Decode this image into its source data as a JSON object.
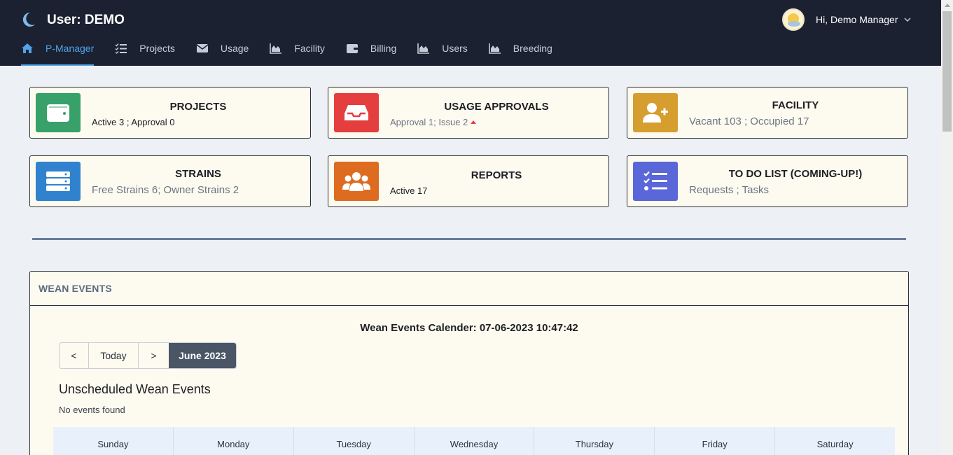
{
  "header": {
    "title": "User: DEMO",
    "greeting": "Hi, Demo Manager",
    "nav": [
      {
        "label": "P-Manager",
        "icon": "home-icon",
        "active": true
      },
      {
        "label": "Projects",
        "icon": "checklist-icon"
      },
      {
        "label": "Usage",
        "icon": "envelope-icon"
      },
      {
        "label": "Facility",
        "icon": "area-chart-icon"
      },
      {
        "label": "Billing",
        "icon": "wallet-icon"
      },
      {
        "label": "Users",
        "icon": "area-chart-icon"
      },
      {
        "label": "Breeding",
        "icon": "area-chart-icon"
      }
    ]
  },
  "cards": {
    "projects": {
      "title": "PROJECTS",
      "subtitle": "Active 3 ; Approval 0",
      "color": "#38a169",
      "icon": "wallet-icon"
    },
    "usage": {
      "title": "USAGE APPROVALS",
      "subtitle": "Approval 1; Issue 2",
      "color": "#e53e3e",
      "icon": "inbox-icon"
    },
    "facility": {
      "title": "FACILITY",
      "subtitle": "Vacant 103 ; Occupied 17",
      "color": "#d69e2e",
      "icon": "add-user-icon"
    },
    "strains": {
      "title": "STRAINS",
      "subtitle": "Free Strains 6; Owner Strains 2",
      "color": "#3182ce",
      "icon": "server-icon"
    },
    "reports": {
      "title": "REPORTS",
      "subtitle": "Active 17",
      "color": "#dd6b20",
      "icon": "users-icon"
    },
    "todo": {
      "title": "TO DO LIST (COMING-UP!)",
      "subtitle": "Requests ; Tasks",
      "color": "#5a67d8",
      "icon": "task-list-icon"
    }
  },
  "wean": {
    "panel_title": "WEAN EVENTS",
    "calendar_heading": "Wean Events Calender: 07-06-2023 10:47:42",
    "prev_label": "<",
    "today_label": "Today",
    "next_label": ">",
    "month_label": "June 2023",
    "unscheduled_title": "Unscheduled Wean Events",
    "no_events": "No events found",
    "weekdays": [
      "Sunday",
      "Monday",
      "Tuesday",
      "Wednesday",
      "Thursday",
      "Friday",
      "Saturday"
    ]
  }
}
